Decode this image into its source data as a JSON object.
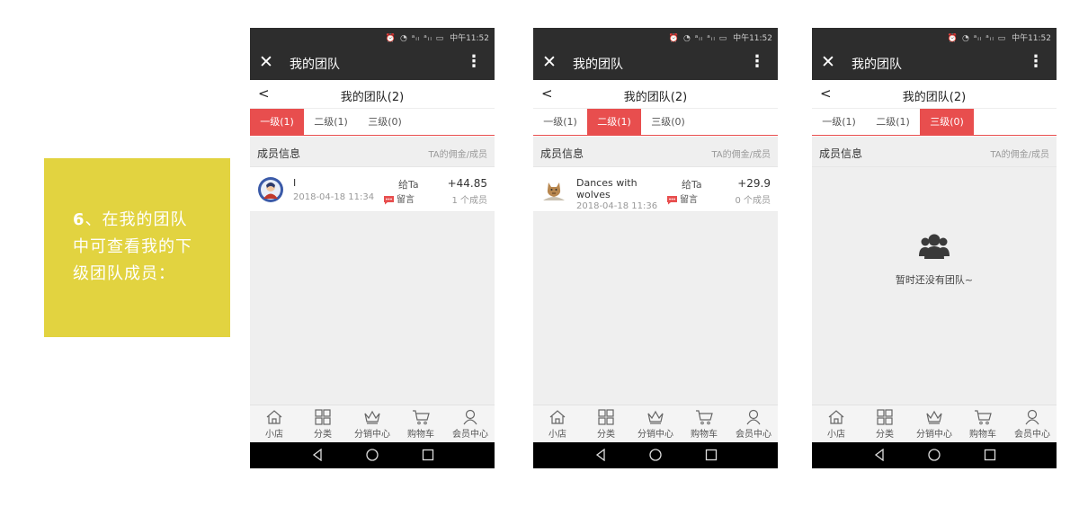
{
  "callout": {
    "num": "6",
    "lines": [
      "、在我的团队",
      "中可查看我的下",
      "级团队成员："
    ]
  },
  "colors": {
    "accent": "#e84e4e",
    "callout_bg": "#e2d340",
    "appbar_bg": "#2d2d2d"
  },
  "phones": [
    {
      "status": {
        "icons": "⏰ ◔ ᵃᵢₗ ᵃᵢₗ ▭",
        "time": "中午11:52"
      },
      "appbar": {
        "title": "我的团队",
        "close_icon": "close-icon",
        "more_icon": "more-vertical-icon"
      },
      "nav": {
        "back": "<",
        "title": "我的团队(2)"
      },
      "tabs": [
        "一级(1)",
        "二级(1)",
        "三级(0)"
      ],
      "active_tab": 0,
      "section": {
        "left": "成员信息",
        "right": "TA的佣金/成员"
      },
      "member": {
        "name": "I",
        "date": "2018-04-18 11:34",
        "give": "给Ta",
        "msg": "留言",
        "amount": "+44.85",
        "count": "1 个成员"
      },
      "tabbar": [
        "小店",
        "分类",
        "分销中心",
        "购物车",
        "会员中心"
      ]
    },
    {
      "status": {
        "icons": "⏰ ◔ ᵃᵢₗ ᵃᵢₗ ▭",
        "time": "中午11:52"
      },
      "appbar": {
        "title": "我的团队"
      },
      "nav": {
        "back": "<",
        "title": "我的团队(2)"
      },
      "tabs": [
        "一级(1)",
        "二级(1)",
        "三级(0)"
      ],
      "active_tab": 1,
      "section": {
        "left": "成员信息",
        "right": "TA的佣金/成员"
      },
      "member": {
        "name_line1": "Dances with",
        "name_line2": "wolves",
        "date": "2018-04-18 11:36",
        "give": "给Ta",
        "msg": "留言",
        "amount": "+29.9",
        "count": "0 个成员"
      },
      "tabbar": [
        "小店",
        "分类",
        "分销中心",
        "购物车",
        "会员中心"
      ]
    },
    {
      "status": {
        "icons": "⏰ ◔ ᵃᵢₗ ᵃᵢₗ ▭",
        "time": "中午11:52"
      },
      "appbar": {
        "title": "我的团队"
      },
      "nav": {
        "back": "<",
        "title": "我的团队(2)"
      },
      "tabs": [
        "一级(1)",
        "二级(1)",
        "三级(0)"
      ],
      "active_tab": 2,
      "section": {
        "left": "成员信息",
        "right": "TA的佣金/成员"
      },
      "empty_text": "暂时还没有团队~",
      "tabbar": [
        "小店",
        "分类",
        "分销中心",
        "购物车",
        "会员中心"
      ]
    }
  ]
}
